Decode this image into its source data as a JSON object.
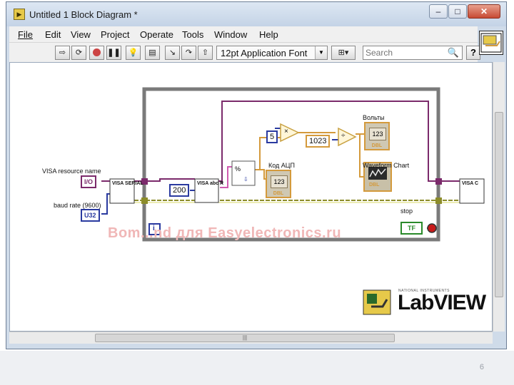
{
  "window": {
    "title": "Untitled 1 Block Diagram *"
  },
  "menu": [
    "File",
    "Edit",
    "View",
    "Project",
    "Operate",
    "Tools",
    "Window",
    "Help"
  ],
  "toolbar": {
    "font": "12pt Application Font",
    "search_placeholder": "Search",
    "help": "?"
  },
  "diagram": {
    "visa_resource_label": "VISA resource name",
    "visa_resource_const": "I/O",
    "baud_label": "baud rate (9600)",
    "baud_const": "U32",
    "configure_node": "VISA SERIAL",
    "read_node": "VISA abc R",
    "close_node": "VISA C",
    "bytes_const": "200",
    "mult_const": "5",
    "divisor_const": "1023",
    "multiply_symbol": "×",
    "divide_symbol": "÷",
    "volts_label": "Вольты",
    "volts_value": "123",
    "volts_type": "DBL",
    "adc_label": "Код АЦП",
    "adc_value": "123",
    "adc_type": "DBL",
    "chart_label": "Waveform Chart",
    "chart_type": "DBL",
    "stop_label": "stop",
    "stop_const": "TF",
    "iteration": "i",
    "watermark": "Bom...nd для Easyelectronics.ru"
  },
  "logo": {
    "brand": "LabVIEW",
    "vendor": "NATIONAL INSTRUMENTS"
  },
  "slide_number": "6",
  "colors": {
    "loop_border": "#7a7a7a",
    "visa_wire": "#7b2a6b",
    "error_wire": "#8c8c2a",
    "numeric_wire": "#d49a3c",
    "int_wire": "#2a3aa0"
  }
}
